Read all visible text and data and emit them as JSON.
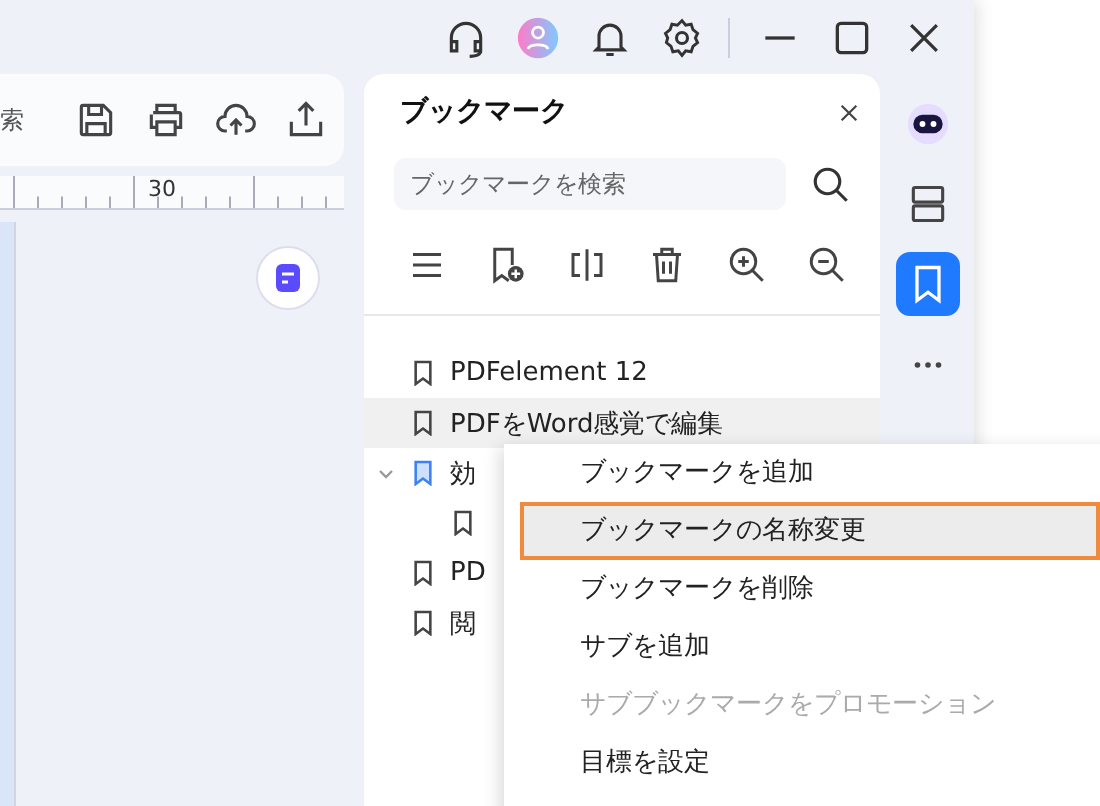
{
  "toolbar": {
    "cut_label": "索"
  },
  "ruler": {
    "label": "30"
  },
  "panel": {
    "title": "ブックマーク",
    "search": {
      "placeholder": "ブックマークを検索"
    }
  },
  "bookmarks": [
    {
      "label": "PDFelement 12",
      "selected": false,
      "hovered": false
    },
    {
      "label": "PDFをWord感覚で編集",
      "selected": false,
      "hovered": true
    },
    {
      "label": "効",
      "selected": true,
      "hovered": false,
      "expanded": true,
      "children": [
        {
          "selected": false,
          "hovered": false
        }
      ]
    },
    {
      "label": "PD",
      "selected": false,
      "hovered": false
    },
    {
      "label": "閲",
      "selected": false,
      "hovered": false
    }
  ],
  "context_menu": [
    {
      "label": "ブックマークを追加",
      "selected": false,
      "disabled": false
    },
    {
      "label": "ブックマークの名称変更",
      "selected": true,
      "disabled": false
    },
    {
      "label": "ブックマークを削除",
      "selected": false,
      "disabled": false
    },
    {
      "label": "サブを追加",
      "selected": false,
      "disabled": false
    },
    {
      "label": "サブブックマークをプロモーション",
      "selected": false,
      "disabled": true
    },
    {
      "label": "目標を設定",
      "selected": false,
      "disabled": false
    }
  ],
  "rail": [
    {
      "kind": "ai",
      "selected": false
    },
    {
      "kind": "layout",
      "selected": false
    },
    {
      "kind": "bookmark",
      "selected": true
    },
    {
      "kind": "more",
      "selected": false
    }
  ]
}
